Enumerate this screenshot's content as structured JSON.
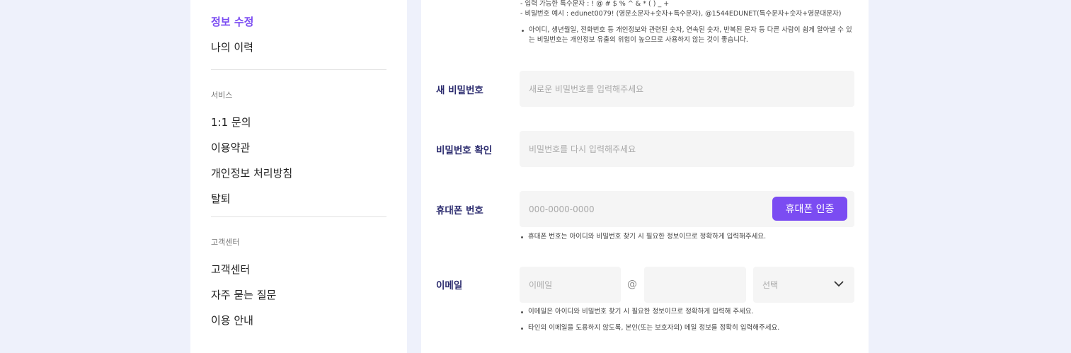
{
  "sidebar": {
    "account": [
      {
        "label": "정보 수정",
        "active": true
      },
      {
        "label": "나의 이력",
        "active": false
      }
    ],
    "service_section": "서비스",
    "service": [
      {
        "label": "1:1 문의"
      },
      {
        "label": "이용약관"
      },
      {
        "label": "개인정보 처리방침"
      },
      {
        "label": "탈퇴"
      }
    ],
    "support_section": "고객센터",
    "support": [
      {
        "label": "고객센터"
      },
      {
        "label": "자주 묻는 질문"
      },
      {
        "label": "이용 안내"
      }
    ]
  },
  "form": {
    "password_rules": {
      "line1": "- 입력 가능한 특수문자 : ! @ # $ % ^ & * ( ) _ +",
      "line2": "- 비밀번호 예시 : edunet0079! (영문소문자+숫자+특수문자), @1544EDUNET(특수문자+숫자+영문대문자)",
      "note": "아이디, 생년월일, 전화번호 등 개인정보와 관련된 숫자, 연속된 숫자, 반복된 문자 등 다른 사람이 쉽게 알아낼 수 있는 비밀번호는 개인정보 유출의 위험이 높으므로 사용하지 않는 것이 좋습니다."
    },
    "new_password": {
      "label": "새 비밀번호",
      "placeholder": "새로운 비밀번호를 입력해주세요"
    },
    "confirm_password": {
      "label": "비밀번호 확인",
      "placeholder": "비밀번호를 다시 입력해주세요"
    },
    "phone": {
      "label": "휴대폰 번호",
      "placeholder": "000-0000-0000",
      "button": "휴대폰 인증",
      "note": "휴대폰 번호는 아이디와 비밀번호 찾기 시 필요한 정보이므로 정확하게 입력해주세요."
    },
    "email": {
      "label": "이메일",
      "local_placeholder": "이메일",
      "at": "@",
      "domain_placeholder": "",
      "select_label": "선택",
      "note1": "이메일은 아이디와 비밀번호 찾기 시 필요한 정보이므로 정확하게 입력해 주세요.",
      "note2": "타인의 이메일을 도용하지 않도록, 본인(또는 보호자의) 메일 정보를 정확히 입력해주세요."
    }
  },
  "colors": {
    "accent": "#7b4cf2",
    "label": "#2b2b6e",
    "background": "#eef1fb"
  },
  "icons": {
    "select": "chevron-down-icon"
  }
}
